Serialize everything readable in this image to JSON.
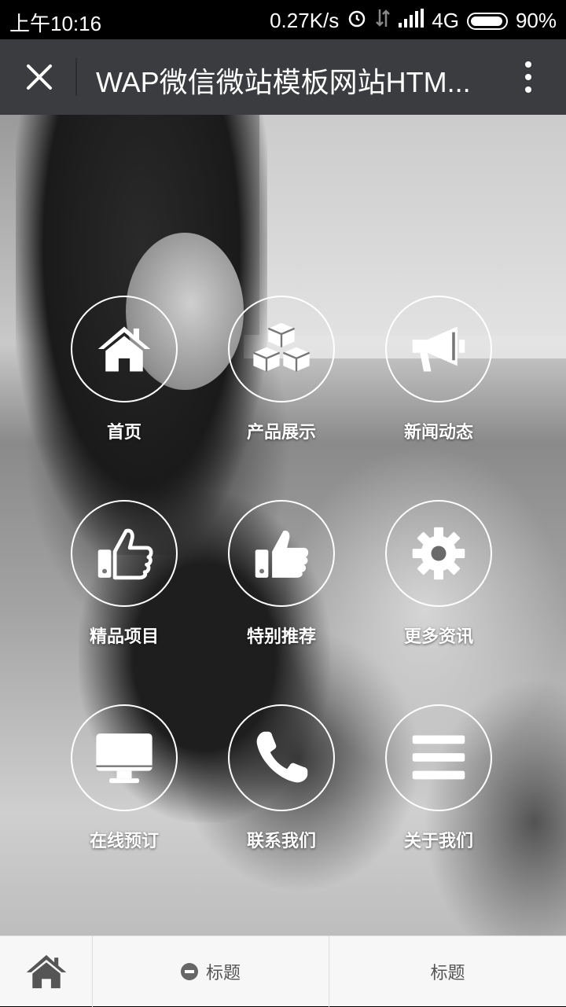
{
  "status_bar": {
    "time": "上午10:16",
    "network_speed": "0.27K/s",
    "network_type": "4G",
    "battery": "90%"
  },
  "title_bar": {
    "title": "WAP微信微站模板网站HTM..."
  },
  "menu": [
    {
      "label": "首页",
      "icon": "home-icon"
    },
    {
      "label": "产品展示",
      "icon": "cubes-icon"
    },
    {
      "label": "新闻动态",
      "icon": "megaphone-icon"
    },
    {
      "label": "精品项目",
      "icon": "thumbs-up-outline-icon"
    },
    {
      "label": "特别推荐",
      "icon": "thumbs-up-icon"
    },
    {
      "label": "更多资讯",
      "icon": "gear-icon"
    },
    {
      "label": "在线预订",
      "icon": "desktop-icon"
    },
    {
      "label": "联系我们",
      "icon": "phone-icon"
    },
    {
      "label": "关于我们",
      "icon": "list-icon"
    }
  ],
  "bottom_nav": {
    "home_icon": "home-icon",
    "item2_label": "标题",
    "item3_label": "标题"
  },
  "colors": {
    "title_bar_bg": "#3b3c40",
    "bottom_nav_bg": "#f7f7f7"
  }
}
